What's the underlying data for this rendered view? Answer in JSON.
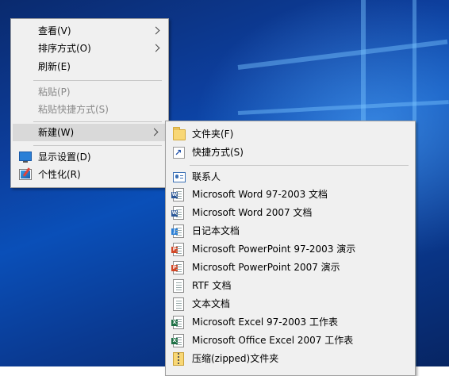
{
  "main_menu": {
    "items": [
      {
        "label": "查看(V)",
        "has_submenu": true
      },
      {
        "label": "排序方式(O)",
        "has_submenu": true
      },
      {
        "label": "刷新(E)",
        "has_submenu": false
      },
      {
        "label": "粘贴(P)",
        "disabled": true
      },
      {
        "label": "粘贴快捷方式(S)",
        "disabled": true
      },
      {
        "label": "新建(W)",
        "has_submenu": true,
        "selected": true
      },
      {
        "label": "显示设置(D)",
        "icon": "display-settings-icon"
      },
      {
        "label": "个性化(R)",
        "icon": "personalize-icon"
      }
    ]
  },
  "new_submenu": {
    "items": [
      {
        "label": "文件夹(F)",
        "icon": "folder-icon"
      },
      {
        "label": "快捷方式(S)",
        "icon": "shortcut-icon"
      },
      {
        "label": "联系人",
        "icon": "contact-icon"
      },
      {
        "label": "Microsoft Word 97-2003 文档",
        "icon": "word-doc-icon"
      },
      {
        "label": "Microsoft Word 2007 文档",
        "icon": "word-doc-icon"
      },
      {
        "label": "日记本文档",
        "icon": "journal-doc-icon"
      },
      {
        "label": "Microsoft PowerPoint 97-2003 演示",
        "icon": "powerpoint-icon"
      },
      {
        "label": "Microsoft PowerPoint 2007 演示",
        "icon": "powerpoint-icon"
      },
      {
        "label": "RTF 文档",
        "icon": "rtf-doc-icon"
      },
      {
        "label": "文本文档",
        "icon": "text-doc-icon"
      },
      {
        "label": "Microsoft Excel 97-2003 工作表",
        "icon": "excel-icon"
      },
      {
        "label": "Microsoft Office Excel 2007 工作表",
        "icon": "excel-icon"
      },
      {
        "label": "压缩(zipped)文件夹",
        "icon": "zip-folder-icon"
      }
    ]
  },
  "colors": {
    "menu_bg": "#f0f0f0",
    "selected_bg": "#d9d9d9",
    "disabled_text": "#8a8a8a",
    "word": "#2b5797",
    "powerpoint": "#d24726",
    "excel": "#1e7145"
  }
}
